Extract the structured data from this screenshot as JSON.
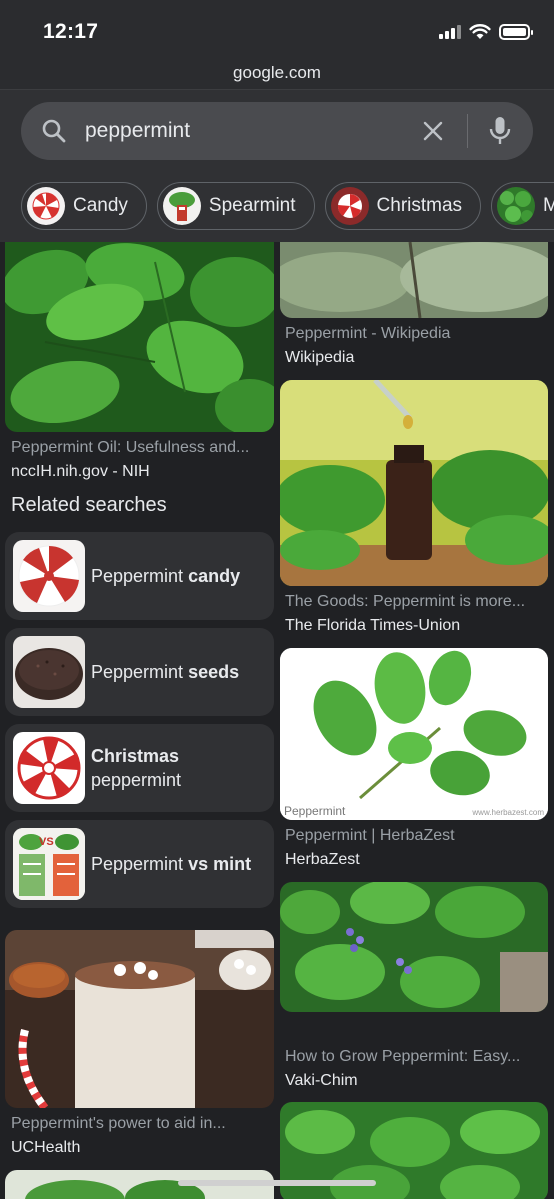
{
  "status_bar": {
    "time": "12:17"
  },
  "browser": {
    "url": "google.com"
  },
  "search": {
    "query": "peppermint"
  },
  "chips": [
    {
      "label": "Candy"
    },
    {
      "label": "Spearmint"
    },
    {
      "label": "Christmas"
    },
    {
      "label": "M"
    }
  ],
  "results": {
    "left": [
      {
        "title": "Peppermint Oil: Usefulness and...",
        "source": "nccIH.nih.gov - NIH"
      },
      {
        "title": "Peppermint's power to aid in...",
        "source": "UCHealth"
      }
    ],
    "right": [
      {
        "title": "Peppermint - Wikipedia",
        "source": "Wikipedia"
      },
      {
        "title": "The Goods: Peppermint is more...",
        "source": "The Florida Times-Union"
      },
      {
        "title": "Peppermint | HerbaZest",
        "source": "HerbaZest",
        "watermark": "Peppermint",
        "watermark_url": "www.herbazest.com"
      },
      {
        "title": "How to Grow Peppermint: Easy...",
        "source": "Vaki-Chim"
      }
    ]
  },
  "related": {
    "title": "Related searches",
    "items": [
      {
        "plain": "Peppermint ",
        "bold": "candy",
        "bold_first": false
      },
      {
        "plain": "Peppermint ",
        "bold": "seeds",
        "bold_first": false
      },
      {
        "plain": "peppermint",
        "bold": "Christmas",
        "bold_first": true
      },
      {
        "plain": "Peppermint ",
        "bold": "vs mint",
        "bold_first": false,
        "thumb_text": "VS"
      }
    ]
  },
  "colors": {
    "background": "#202124",
    "surface": "#303134",
    "text": "#e8eaed",
    "muted": "#9aa0a6"
  }
}
